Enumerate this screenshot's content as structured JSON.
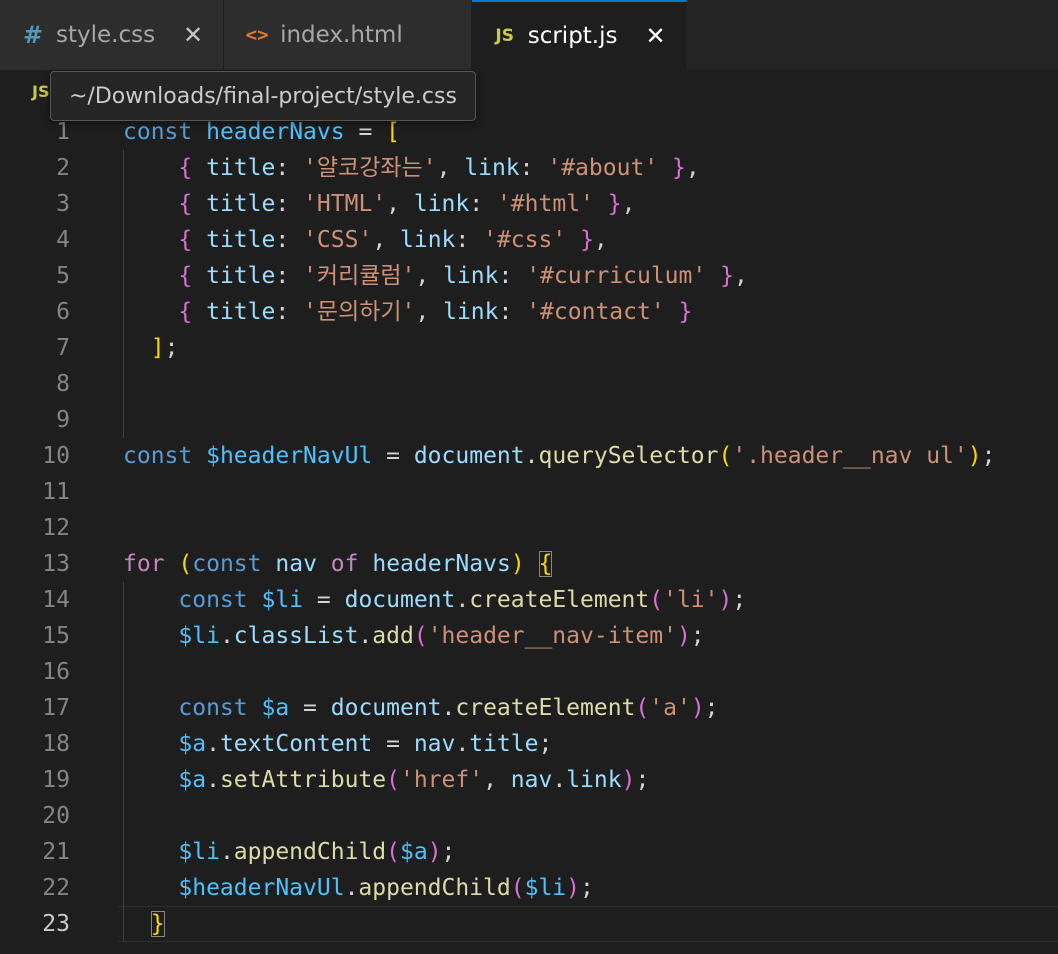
{
  "tabs": [
    {
      "icon": "#",
      "icon_name": "css-hash-icon",
      "label": "style.css",
      "active": false,
      "close": "✕"
    },
    {
      "icon": "<>",
      "icon_name": "html-brackets-icon",
      "label": "index.html",
      "active": false,
      "close": ""
    },
    {
      "icon": "JS",
      "icon_name": "js-file-icon",
      "label": "script.js",
      "active": true,
      "close": "✕"
    }
  ],
  "breadcrumb": {
    "icon": "JS"
  },
  "tooltip": {
    "text": "~/Downloads/final-project/style.css"
  },
  "editor": {
    "current_line": 23,
    "line_numbers": [
      "1",
      "2",
      "3",
      "4",
      "5",
      "6",
      "7",
      "8",
      "9",
      "10",
      "11",
      "12",
      "13",
      "14",
      "15",
      "16",
      "17",
      "18",
      "19",
      "20",
      "21",
      "22",
      "23"
    ],
    "lines": [
      "const headerNavs = [",
      "    { title: '얄코강좌는', link: '#about' },",
      "    { title: 'HTML', link: '#html' },",
      "    { title: 'CSS', link: '#css' },",
      "    { title: '커리큘럼', link: '#curriculum' },",
      "    { title: '문의하기', link: '#contact' }",
      "  ];",
      "",
      "",
      "const $headerNavUl = document.querySelector('.header__nav ul');",
      "",
      "",
      "for (const nav of headerNavs) {",
      "    const $li = document.createElement('li');",
      "    $li.classList.add('header__nav-item');",
      "",
      "    const $a = document.createElement('a');",
      "    $a.textContent = nav.title;",
      "    $a.setAttribute('href', nav.link);",
      "",
      "    $li.appendChild($a);",
      "    $headerNavUl.appendChild($li);",
      "  }"
    ]
  },
  "colors": {
    "background": "#1e1e1e",
    "tabbar": "#252526",
    "active_tab_border": "#0078d4",
    "keyword": "#569cd6",
    "control": "#c586c0",
    "variable": "#4fc1ff",
    "property": "#9cdcfe",
    "function": "#dcdcaa",
    "string": "#ce9178",
    "bracket_1": "#ffd700",
    "bracket_2": "#da70d6",
    "bracket_3": "#179fff"
  }
}
